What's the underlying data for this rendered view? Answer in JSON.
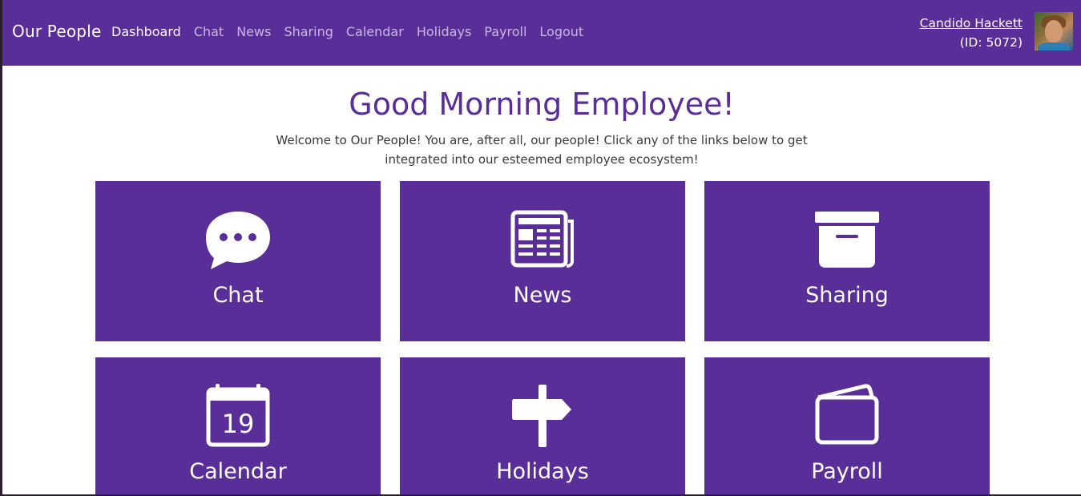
{
  "nav": {
    "brand": "Our People",
    "links": [
      "Dashboard",
      "Chat",
      "News",
      "Sharing",
      "Calendar",
      "Holidays",
      "Payroll",
      "Logout"
    ],
    "active": "Dashboard"
  },
  "user": {
    "name": "Candido Hackett",
    "id_text": "(ID: 5072)"
  },
  "main": {
    "greeting": "Good Morning Employee!",
    "intro": "Welcome to Our People! You are, after all, our people! Click any of the links below to get integrated into our esteemed employee ecosystem!"
  },
  "tiles": [
    {
      "label": "Chat",
      "icon": "chat-bubble-icon"
    },
    {
      "label": "News",
      "icon": "newspaper-icon"
    },
    {
      "label": "Sharing",
      "icon": "archive-box-icon"
    },
    {
      "label": "Calendar",
      "icon": "calendar-icon",
      "icon_text": "19"
    },
    {
      "label": "Holidays",
      "icon": "signpost-icon"
    },
    {
      "label": "Payroll",
      "icon": "wallet-icon"
    }
  ],
  "colors": {
    "brand": "#5a2e98",
    "nav_inactive": "#c8b8e4",
    "text": "#3a3a3a"
  }
}
